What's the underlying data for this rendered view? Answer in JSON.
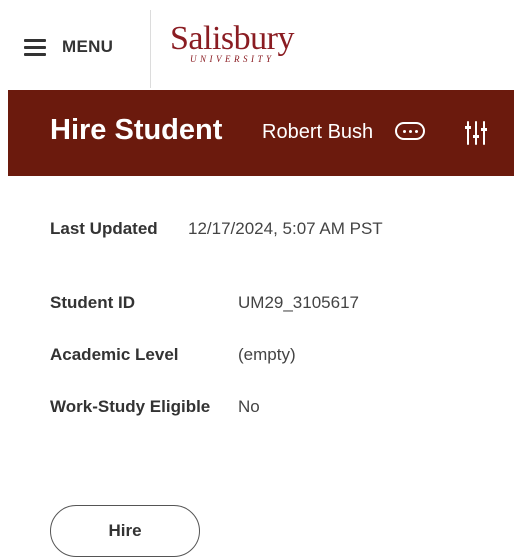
{
  "header": {
    "menu_label": "MENU",
    "logo": {
      "name": "Salisbury",
      "subtitle": "UNIVERSITY"
    }
  },
  "banner": {
    "title": "Hire Student",
    "student_name": "Robert Bush"
  },
  "details": {
    "last_updated": {
      "label": "Last Updated",
      "value": "12/17/2024, 5:07 AM PST"
    },
    "student_id": {
      "label": "Student ID",
      "value": "UM29_3105617"
    },
    "academic_level": {
      "label": "Academic Level",
      "value": "(empty)"
    },
    "work_study": {
      "label": "Work-Study Eligible",
      "value": "No"
    }
  },
  "actions": {
    "hire_label": "Hire"
  },
  "colors": {
    "brand": "#6b1a0d",
    "logo": "#8a1c22"
  }
}
